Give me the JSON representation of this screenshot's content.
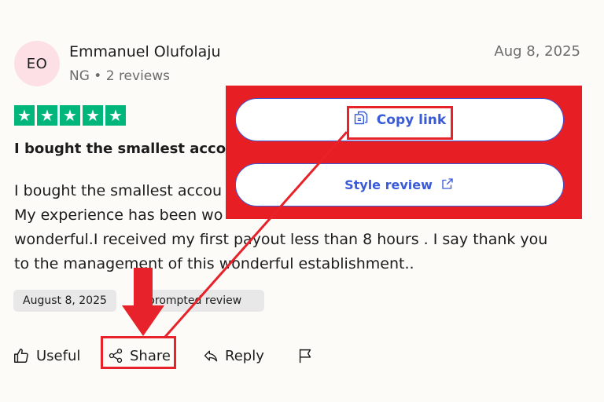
{
  "reviewer": {
    "initials": "EO",
    "name": "Emmanuel Olufolaju",
    "meta": "NG • 2 reviews",
    "date": "Aug 8, 2025"
  },
  "rating": {
    "stars": 5,
    "max": 5,
    "star_glyph": "★"
  },
  "review": {
    "title": "I bought the smallest acco",
    "body_lines": [
      "I bought the smallest accou",
      "My experience has been wo",
      "wonderful.I received my first payout less than 8 hours . I say thank you",
      "to the management of this wonderful establishment.."
    ]
  },
  "chips": {
    "date": "August 8, 2025",
    "type": "prompted review"
  },
  "actions": {
    "useful": "Useful",
    "share": "Share",
    "reply": "Reply"
  },
  "share_popup": {
    "copy_link": "Copy link",
    "style_review": "Style review"
  },
  "colors": {
    "annotation_red": "#e8222a",
    "star_green": "#00b67a",
    "link_blue": "#3a5bd9"
  }
}
